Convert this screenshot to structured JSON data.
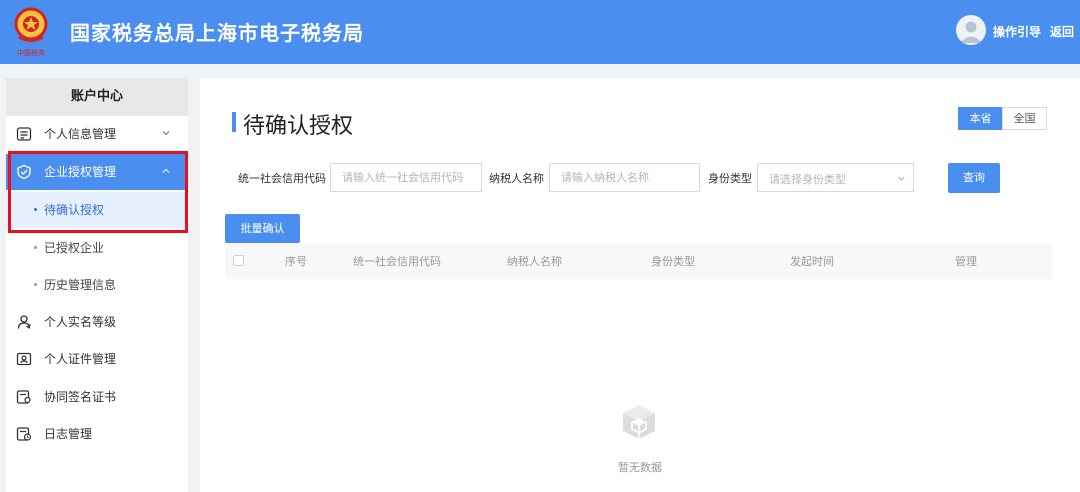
{
  "header": {
    "emblem_text": "中国税务",
    "title": "国家税务总局上海市电子税务局",
    "guide_label": "操作引导",
    "back_label": "返回"
  },
  "sidebar": {
    "heading": "账户中心",
    "items": [
      {
        "label": "个人信息管理",
        "icon": "profile-card-icon"
      },
      {
        "label": "企业授权管理",
        "icon": "shield-check-icon"
      },
      {
        "label": "待确认授权"
      },
      {
        "label": "已授权企业"
      },
      {
        "label": "历史管理信息"
      },
      {
        "label": "个人实名等级",
        "icon": "person-level-icon"
      },
      {
        "label": "个人证件管理",
        "icon": "id-card-icon"
      },
      {
        "label": "协同签名证书",
        "icon": "certificate-icon"
      },
      {
        "label": "日志管理",
        "icon": "log-icon"
      }
    ]
  },
  "main": {
    "title": "待确认授权",
    "scope": {
      "local": "本省",
      "national": "全国"
    },
    "filters": {
      "credit_code_label": "统一社会信用代码",
      "credit_code_placeholder": "请输入统一社会信用代码",
      "taxpayer_label": "纳税人名称",
      "taxpayer_placeholder": "请输入纳税人名称",
      "identity_label": "身份类型",
      "identity_placeholder": "请选择身份类型",
      "search_button": "查询"
    },
    "batch_button": "批量确认",
    "table": {
      "columns": [
        "序号",
        "统一社会信用代码",
        "纳税人名称",
        "身份类型",
        "发起时间",
        "管理"
      ]
    },
    "empty_text": "暂无数据"
  },
  "colors": {
    "primary": "#4a8ff0",
    "highlight_box": "#e8101e"
  }
}
